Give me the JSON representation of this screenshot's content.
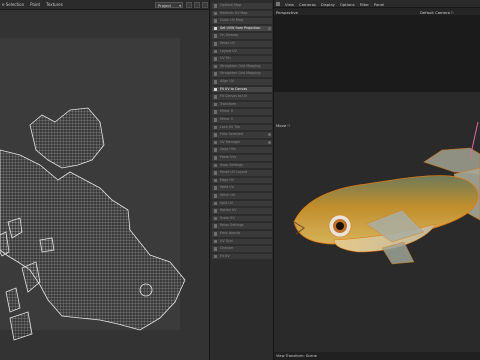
{
  "uv_editor": {
    "menu": [
      "e Selection",
      "Paint",
      "Textures"
    ],
    "mode_dropdown": "Project"
  },
  "tools": {
    "items": [
      {
        "label": "Optimal Map",
        "active": false,
        "toggle": false
      },
      {
        "label": "Realistic UV Map",
        "active": false,
        "toggle": false
      },
      {
        "label": "Cubic UV Map",
        "active": false,
        "toggle": false
      },
      {
        "label": "Set UVW from Projection",
        "active": true,
        "toggle": true
      },
      {
        "label": "Un-Unwrap",
        "active": false,
        "toggle": false
      },
      {
        "label": "Relax UV",
        "active": false,
        "toggle": false
      },
      {
        "label": "Layout UV",
        "active": false,
        "toggle": false
      },
      {
        "label": "UV Pin",
        "active": false,
        "toggle": false
      },
      {
        "label": "Straighten Grid Mapping",
        "active": false,
        "toggle": false
      },
      {
        "label": "Straighten Grid Mapping",
        "active": false,
        "toggle": false
      },
      {
        "label": "Align UV",
        "active": false,
        "toggle": false
      },
      {
        "label": "Fit UV to Canvas",
        "active": true,
        "toggle": false
      },
      {
        "label": "Fit Canvas to UV",
        "active": false,
        "toggle": false
      },
      {
        "label": "Transform",
        "active": false,
        "toggle": false
      },
      {
        "label": "Mirror U",
        "active": false,
        "toggle": false
      },
      {
        "label": "Mirror V",
        "active": false,
        "toggle": false
      },
      {
        "label": "Lock UV Tile",
        "active": false,
        "toggle": false
      },
      {
        "label": "Hide Selected",
        "active": false,
        "toggle": true
      },
      {
        "label": "UV Manager",
        "active": false,
        "toggle": true
      },
      {
        "label": "Copy UVs",
        "active": false,
        "toggle": false
      },
      {
        "label": "Paste UVs",
        "active": false,
        "toggle": false
      },
      {
        "label": "Snap Settings",
        "active": false,
        "toggle": false
      },
      {
        "label": "Reset UV Layout",
        "active": false,
        "toggle": false
      },
      {
        "label": "Edge UV",
        "active": false,
        "toggle": false
      },
      {
        "label": "Weld UV",
        "active": false,
        "toggle": false
      },
      {
        "label": "Stitch UV",
        "active": false,
        "toggle": false
      },
      {
        "label": "Split UV",
        "active": false,
        "toggle": false
      },
      {
        "label": "Rotate UV",
        "active": false,
        "toggle": false
      },
      {
        "label": "Scale UV",
        "active": false,
        "toggle": false
      },
      {
        "label": "Relax Settings",
        "active": false,
        "toggle": false
      },
      {
        "label": "Pack Islands",
        "active": false,
        "toggle": false
      },
      {
        "label": "UV Grid",
        "active": false,
        "toggle": false
      },
      {
        "label": "Checker",
        "active": false,
        "toggle": false
      },
      {
        "label": "Fit UV",
        "active": false,
        "toggle": false
      }
    ]
  },
  "viewport": {
    "menu": [
      "View",
      "Cameras",
      "Display",
      "Options",
      "Filter",
      "Panel"
    ],
    "title": "Perspective",
    "camera": "Default Camera ⁝⁝",
    "move_label": "Move ⁝⁝",
    "status": "View Transform: Scene"
  },
  "colors": {
    "accent_active": "#f0f0f0",
    "uv_wire": "#d8d8d8",
    "fish_body": "#b98a2a",
    "fish_outline": "#e07a10"
  }
}
